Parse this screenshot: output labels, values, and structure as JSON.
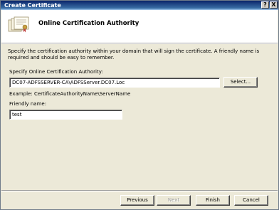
{
  "window": {
    "title": "Create Certificate"
  },
  "title_buttons": {
    "help": "?",
    "close": "X"
  },
  "header": {
    "title": "Online Certification Authority"
  },
  "description": "Specify the certification authority within your domain that will sign the certificate. A friendly name is required and should be easy to remember.",
  "ca": {
    "label": "Specify Online Certification Authority:",
    "value": "DC07-ADFSSERVER-CA\\ADFSServer.DC07.Loc",
    "select_label": "Select...",
    "example": "Example:  CertificateAuthorityName\\ServerName"
  },
  "friendly": {
    "label": "Friendly name:",
    "value": "test"
  },
  "footer": {
    "previous": "Previous",
    "next": "Next",
    "finish": "Finish",
    "cancel": "Cancel"
  }
}
